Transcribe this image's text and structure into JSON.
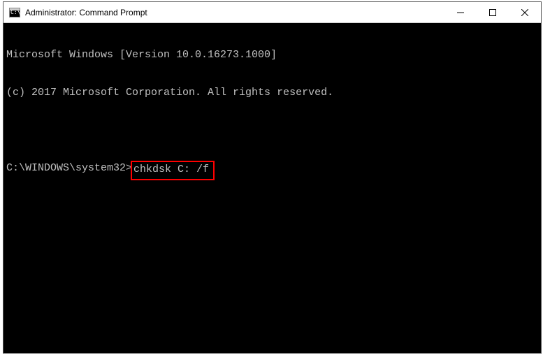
{
  "window": {
    "title": "Administrator: Command Prompt"
  },
  "terminal": {
    "line1": "Microsoft Windows [Version 10.0.16273.1000]",
    "line2": "(c) 2017 Microsoft Corporation. All rights reserved.",
    "prompt": "C:\\WINDOWS\\system32>",
    "command": "chkdsk C: /f"
  }
}
